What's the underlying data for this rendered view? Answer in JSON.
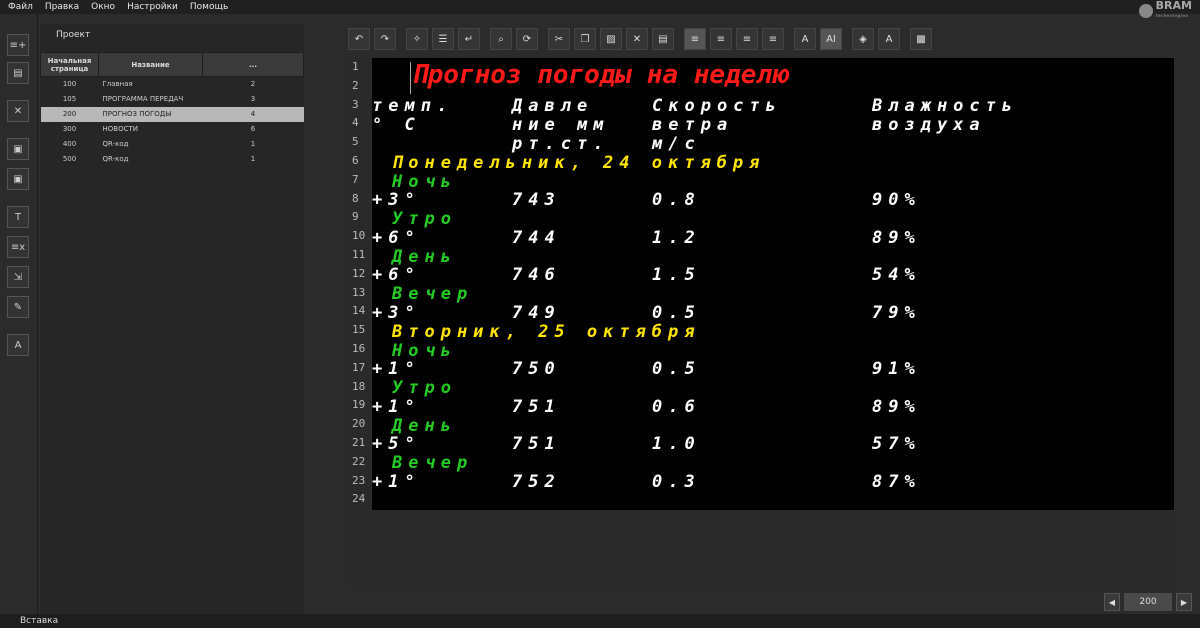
{
  "menu": [
    "Файл",
    "Правка",
    "Окно",
    "Настройки",
    "Помощь"
  ],
  "logo": {
    "name": "BRAM",
    "sub": "technologies"
  },
  "project": {
    "title": "Проект",
    "headers": [
      "Начальная страница",
      "Название",
      "..."
    ],
    "rows": [
      {
        "start": "100",
        "name": "Главная",
        "count": "2"
      },
      {
        "start": "105",
        "name": "ПРОГРАММА ПЕРЕДАЧ",
        "count": "3"
      },
      {
        "start": "200",
        "name": "ПРОГНОЗ ПОГОДЫ",
        "count": "4"
      },
      {
        "start": "300",
        "name": "НОВОСТИ",
        "count": "6"
      },
      {
        "start": "400",
        "name": "QR-код",
        "count": "1"
      },
      {
        "start": "500",
        "name": "QR-код",
        "count": "1"
      }
    ]
  },
  "editor": {
    "line_numbers": [
      "1",
      "2",
      "3",
      "4",
      "5",
      "6",
      "7",
      "8",
      "9",
      "10",
      "11",
      "12",
      "13",
      "14",
      "15",
      "16",
      "17",
      "18",
      "19",
      "20",
      "21",
      "22",
      "23",
      "24"
    ],
    "title": "Прогноз погоды на неделю",
    "headers": {
      "temp": [
        "темп.",
        "° С"
      ],
      "pressure": [
        "Давле",
        "ние мм",
        "рт.ст."
      ],
      "wind": [
        "Скорость",
        "ветра",
        "м/с"
      ],
      "humidity": [
        "Влажность",
        "воздуха"
      ]
    },
    "days": [
      {
        "label": "Понедельник, 24 октября",
        "periods": [
          {
            "name": "Ночь",
            "temp": "+3°",
            "pressure": "743",
            "wind": "0.8",
            "humidity": "90%"
          },
          {
            "name": "Утро",
            "temp": "+6°",
            "pressure": "744",
            "wind": "1.2",
            "humidity": "89%"
          },
          {
            "name": "День",
            "temp": "+6°",
            "pressure": "746",
            "wind": "1.5",
            "humidity": "54%"
          },
          {
            "name": "Вечер",
            "temp": "+3°",
            "pressure": "749",
            "wind": "0.5",
            "humidity": "79%"
          }
        ]
      },
      {
        "label": "Вторник, 25 октября",
        "periods": [
          {
            "name": "Ночь",
            "temp": "+1°",
            "pressure": "750",
            "wind": "0.5",
            "humidity": "91%"
          },
          {
            "name": "Утро",
            "temp": "+1°",
            "pressure": "751",
            "wind": "0.6",
            "humidity": "89%"
          },
          {
            "name": "День",
            "temp": "+5°",
            "pressure": "751",
            "wind": "1.0",
            "humidity": "57%"
          },
          {
            "name": "Вечер",
            "temp": "+1°",
            "pressure": "752",
            "wind": "0.3",
            "humidity": "87%"
          }
        ]
      }
    ]
  },
  "pager": {
    "prev": "◀",
    "page": "200",
    "next": "▶"
  },
  "status": "Вставка",
  "colors": {
    "title": "#ff1a1a",
    "day": "#ffe600",
    "period": "#22cc22",
    "value": "#ffffff",
    "canvas": "#000000"
  }
}
